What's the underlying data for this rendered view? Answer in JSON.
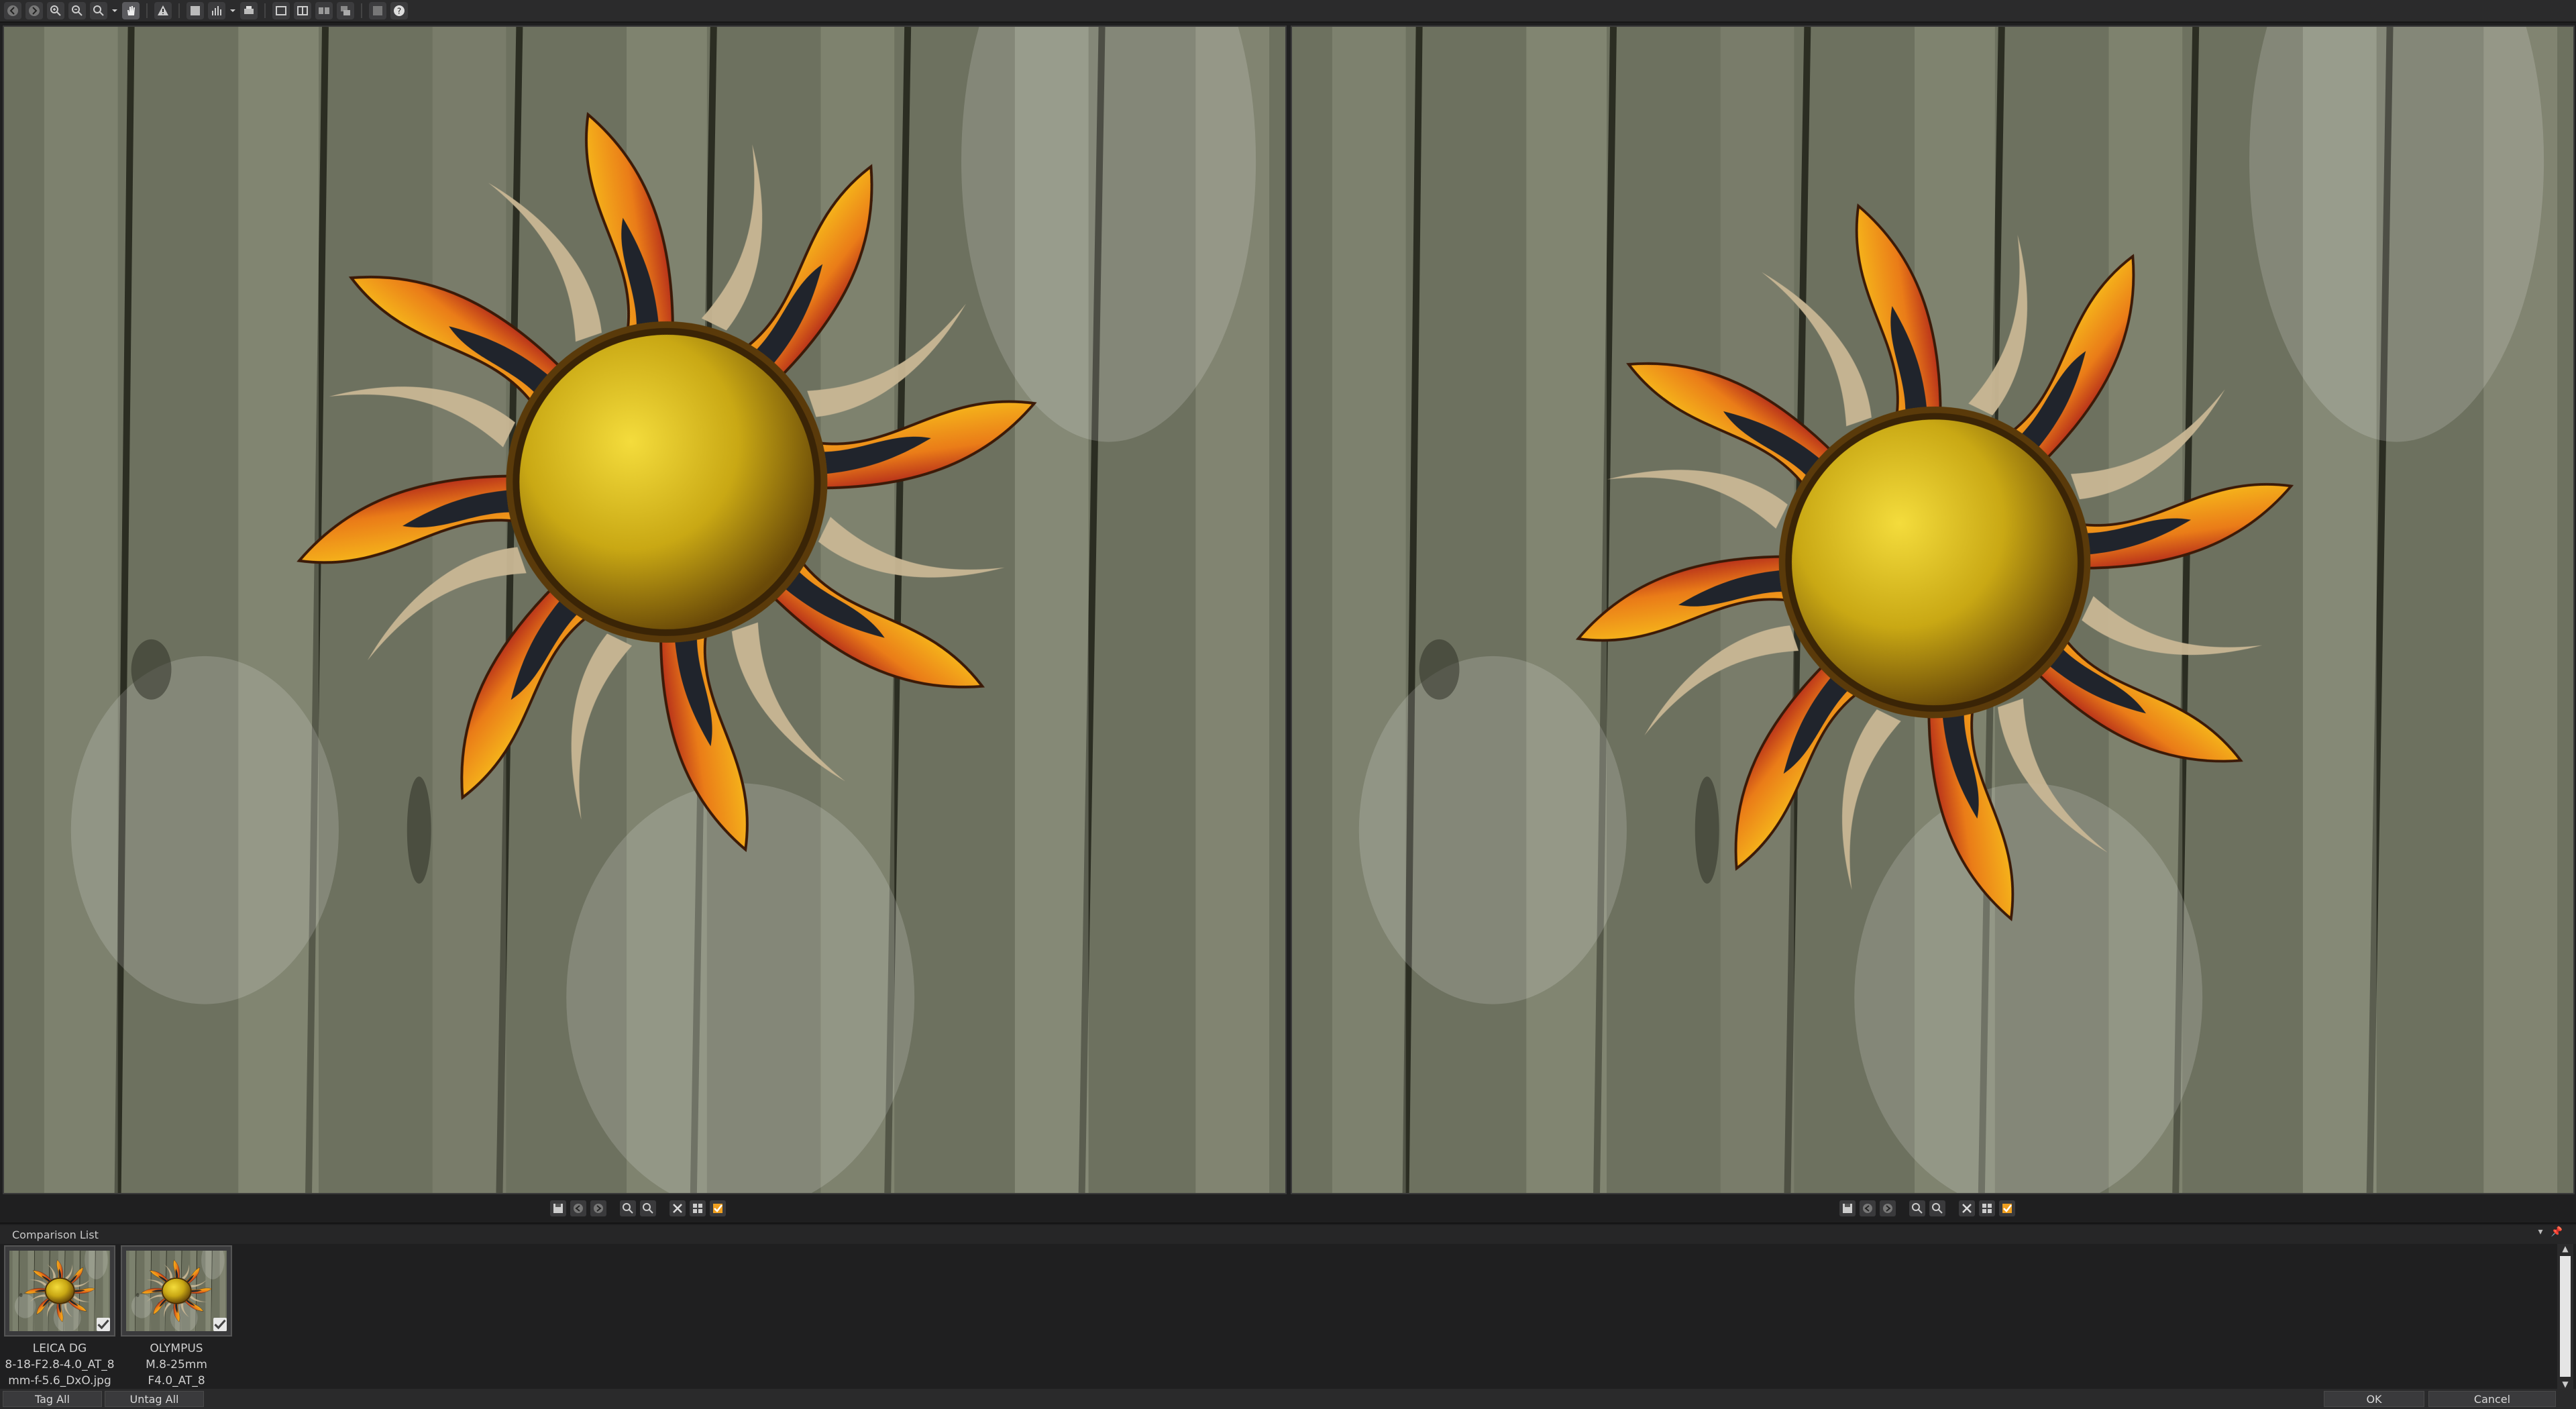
{
  "toolbar": {
    "icons": [
      "back-icon",
      "forward-icon",
      "zoom-in-icon",
      "zoom-out-icon",
      "zoom-fit-icon",
      "hand-tool-icon",
      "warning-icon",
      "compare-icon",
      "histogram-icon",
      "print-icon",
      "view-single-icon",
      "view-split-icon",
      "view-side-icon",
      "view-stack-icon",
      "fullscreen-icon",
      "help-icon"
    ]
  },
  "panes": {
    "left": {
      "photo": "sun-sculpture-on-wooden-fence"
    },
    "right": {
      "photo": "sun-sculpture-on-wooden-fence"
    }
  },
  "comparison_list": {
    "title": "Comparison List",
    "items": [
      {
        "caption_lines": [
          "LEICA DG",
          "8-18-F2.8-4.0_AT_8",
          "mm-f-5.6_DxO.jpg"
        ],
        "tagged": true
      },
      {
        "caption_lines": [
          "OLYMPUS",
          "M.8-25mm",
          "F4.0_AT_8"
        ],
        "tagged": true
      }
    ]
  },
  "bottom": {
    "tag_all": "Tag All",
    "untag_all": "Untag All",
    "ok": "OK",
    "cancel": "Cancel"
  },
  "colors": {
    "background": "#1f1f20",
    "wood": "#6b7060",
    "sun_yellow": "#d9b21a",
    "ray_orange": "#e9821a"
  }
}
